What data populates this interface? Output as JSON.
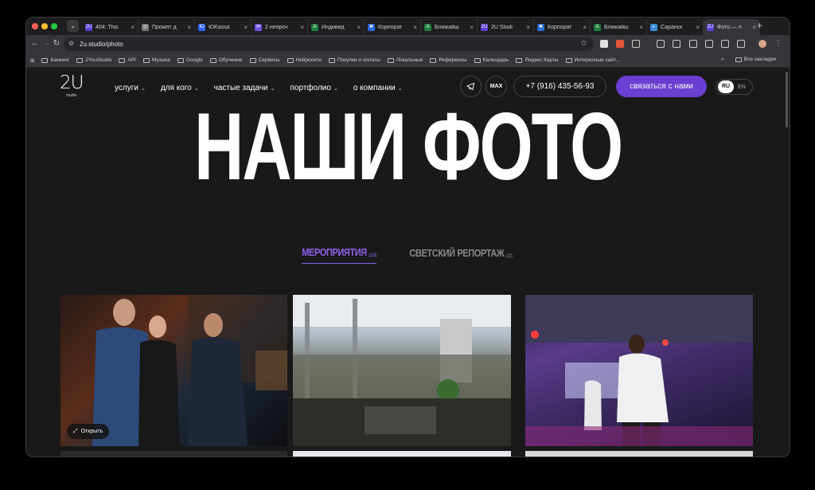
{
  "browser": {
    "tabs": [
      {
        "title": "404: This",
        "fav_color": "#5b3fd1",
        "fav_text": "2U"
      },
      {
        "title": "Промпт д",
        "fav_color": "#777777",
        "fav_text": "◎"
      },
      {
        "title": "ЮKassa",
        "fav_color": "#2b63ff",
        "fav_text": "Ю"
      },
      {
        "title": "2 непроч",
        "fav_color": "#6e4fe0",
        "fav_text": "✉"
      },
      {
        "title": "Индивид",
        "fav_color": "#1e7d3c",
        "fav_text": "A"
      },
      {
        "title": "Корпорат",
        "fav_color": "#2a6bd6",
        "fav_text": "✖"
      },
      {
        "title": "Ближайш",
        "fav_color": "#1e7d3c",
        "fav_text": "A"
      },
      {
        "title": "2U Studi",
        "fav_color": "#5b3fd1",
        "fav_text": "2U"
      },
      {
        "title": "Корпорат",
        "fav_color": "#2a6bd6",
        "fav_text": "✖"
      },
      {
        "title": "Ближайш",
        "fav_color": "#1e7d3c",
        "fav_text": "A"
      },
      {
        "title": "Саранск",
        "fav_color": "#3a8bd6",
        "fav_text": "◐"
      },
      {
        "title": "Фото — п",
        "fav_color": "#5b3fd1",
        "fav_text": "2U"
      }
    ],
    "url": "2u.studio/photo",
    "bookmarks": [
      "Банкинг",
      "2YouStudio",
      "API",
      "Музыка",
      "Google",
      "Обучение",
      "Сервисы",
      "Нейросети",
      "Покупки и оплаты",
      "Локальные",
      "Референсы",
      "Календарь",
      "Яндекс Карты",
      "Интересные сайт..."
    ],
    "bookmarks_more": "»",
    "all_bookmarks": "Все закладки"
  },
  "site": {
    "logo_big": "2U",
    "logo_small": "studio",
    "menu": [
      {
        "label": "услуги"
      },
      {
        "label": "для кого"
      },
      {
        "label": "частые задачи"
      },
      {
        "label": "портфолио"
      },
      {
        "label": "о компании"
      }
    ],
    "max_label": "MAX",
    "phone": "+7 (916) 435-56-93",
    "cta": "связаться с нами",
    "lang_ru": "RU",
    "lang_en": "EN",
    "hero_title": "НАШИ ФОТО",
    "filters": [
      {
        "label": "МЕРОПРИЯТИЯ",
        "count": "(113)",
        "active": true
      },
      {
        "label": "СВЕТСКИЙ РЕПОРТАЖ",
        "count": "(22)",
        "active": false
      }
    ],
    "open_label": "Открыть"
  },
  "colors": {
    "accent": "#6b3fd1",
    "filter_active": "#8a63e8",
    "page_bg": "#19191a"
  }
}
